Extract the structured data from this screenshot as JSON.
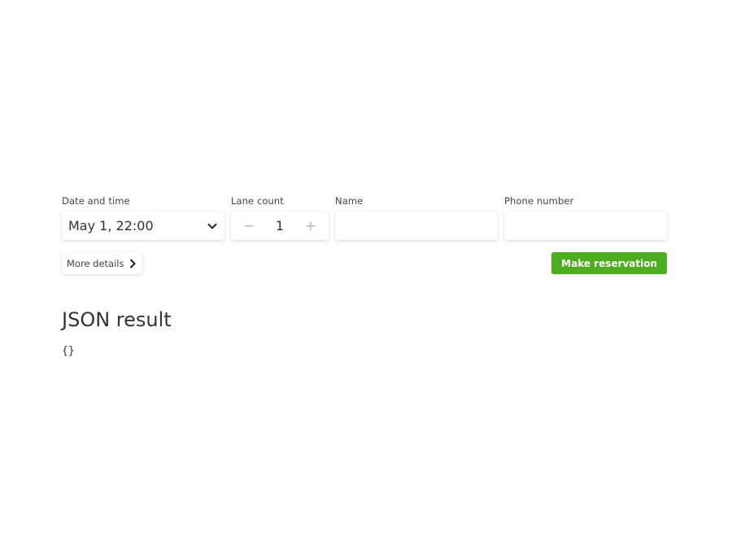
{
  "form": {
    "datetime": {
      "label": "Date and time",
      "value": "May 1, 22:00",
      "icon": "chevron-down-icon"
    },
    "lanes": {
      "label": "Lane count",
      "value": "1",
      "decrement_symbol": "−",
      "increment_symbol": "+"
    },
    "name": {
      "label": "Name",
      "value": "",
      "placeholder": ""
    },
    "phone": {
      "label": "Phone number",
      "value": "",
      "placeholder": ""
    },
    "more_details": {
      "label": "More details",
      "icon": "chevron-right-icon"
    },
    "submit": {
      "label": "Make reservation"
    }
  },
  "result": {
    "title": "JSON result",
    "json": "{}"
  },
  "colors": {
    "accent": "#4cae1f",
    "text": "#333333",
    "muted": "#b8b8b8"
  }
}
